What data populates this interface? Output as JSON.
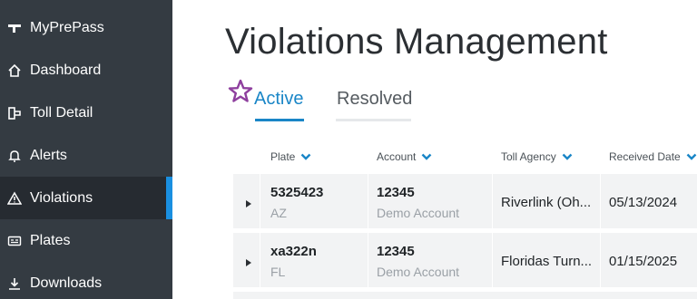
{
  "sidebar": {
    "items": [
      {
        "label": "MyPrePass",
        "icon": "brand-icon"
      },
      {
        "label": "Dashboard",
        "icon": "home-icon"
      },
      {
        "label": "Toll Detail",
        "icon": "toll-detail-icon"
      },
      {
        "label": "Alerts",
        "icon": "bell-icon"
      },
      {
        "label": "Violations",
        "icon": "warning-icon",
        "active": true
      },
      {
        "label": "Plates",
        "icon": "plate-icon"
      },
      {
        "label": "Downloads",
        "icon": "download-icon"
      }
    ]
  },
  "main": {
    "title": "Violations Management",
    "tabs": [
      {
        "label": "Active",
        "selected": true
      },
      {
        "label": "Resolved",
        "selected": false
      }
    ],
    "table": {
      "columns": [
        "Plate",
        "Account",
        "Toll Agency",
        "Received Date"
      ],
      "rows": [
        {
          "plate": "5325423",
          "state": "AZ",
          "account": "12345",
          "account_name": "Demo Account",
          "agency": "Riverlink (Oh...",
          "date": "05/13/2024"
        },
        {
          "plate": "xa322n",
          "state": "FL",
          "account": "12345",
          "account_name": "Demo Account",
          "agency": "Floridas Turn...",
          "date": "01/15/2025"
        }
      ]
    }
  },
  "colors": {
    "sidebar_bg": "#343b42",
    "sidebar_active_bg": "#262b31",
    "accent": "#1a86c7",
    "marker": "#8e3f9e"
  }
}
